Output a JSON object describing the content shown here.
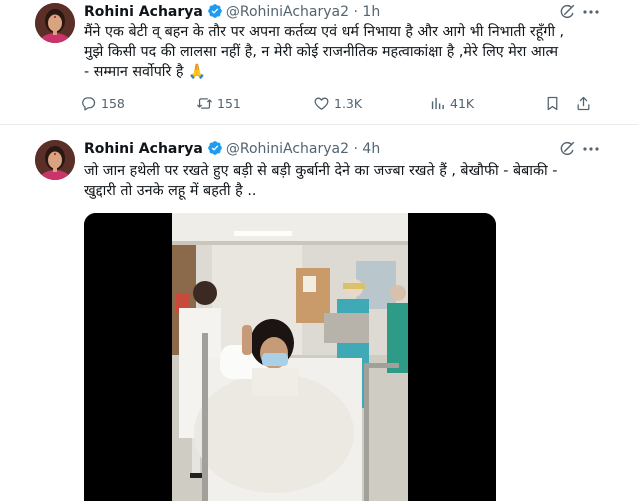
{
  "tweets": [
    {
      "author_name": "Rohini Acharya",
      "handle": "@RohiniAcharya2",
      "separator": "·",
      "time": "1h",
      "text": "मैंने एक बेटी व् बहन के तौर पर अपना कर्तव्य एवं धर्म निभाया है और आगे भी निभाती रहूँगी ,\nमुझे किसी पद की लालसा नहीं है, न मेरी कोई राजनीतिक महत्वाकांक्षा है ,मेरे लिए मेरा आत्म\n- सम्मान सर्वोपरि है 🙏",
      "stats": {
        "replies": "158",
        "reposts": "151",
        "likes": "1.3K",
        "views": "41K"
      }
    },
    {
      "author_name": "Rohini Acharya",
      "handle": "@RohiniAcharya2",
      "separator": "·",
      "time": "4h",
      "text": "जो जान हथेली पर रखते हुए बड़ी से बड़ी कुर्बानी देने का जज्बा रखते हैं , बेखौफी - बेबाकी -\nखुद्दारी तो उनके लहू में बहती है .."
    }
  ],
  "icons": {
    "verified": "verified-badge-icon",
    "grok": "grok-icon",
    "more": "more-icon",
    "reply": "reply-icon",
    "repost": "repost-icon",
    "like": "like-icon",
    "views": "views-icon",
    "bookmark": "bookmark-icon",
    "share": "share-icon"
  },
  "colors": {
    "verified_blue": "#1d9bf0",
    "text_primary": "#0f1419",
    "text_secondary": "#536471"
  }
}
